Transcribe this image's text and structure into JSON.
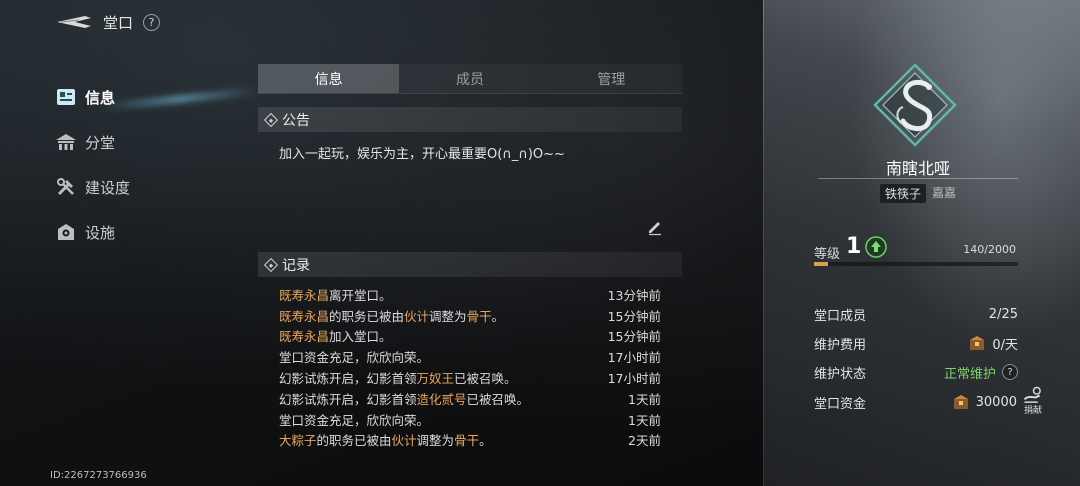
{
  "header": {
    "title": "堂口",
    "help": "?"
  },
  "nav": {
    "items": [
      {
        "label": "信息",
        "icon": "info-icon",
        "active": true
      },
      {
        "label": "分堂",
        "icon": "hall-icon",
        "active": false
      },
      {
        "label": "建设度",
        "icon": "build-tools-icon",
        "active": false
      },
      {
        "label": "设施",
        "icon": "facility-icon",
        "active": false
      }
    ]
  },
  "player_id": "ID:2267273766936",
  "tabs": [
    {
      "label": "信息",
      "active": true
    },
    {
      "label": "成员",
      "active": false
    },
    {
      "label": "管理",
      "active": false
    }
  ],
  "announcement": {
    "heading": "公告",
    "text": "加入一起玩，娱乐为主，开心最重要O(∩_∩)O~~"
  },
  "records": {
    "heading": "记录",
    "rows": [
      {
        "segments": [
          {
            "t": "既寿永昌",
            "hl": true
          },
          {
            "t": "离开堂口。",
            "hl": false
          }
        ],
        "time": "13分钟前"
      },
      {
        "segments": [
          {
            "t": "既寿永昌",
            "hl": true
          },
          {
            "t": "的职务已被由",
            "hl": false
          },
          {
            "t": "伙计",
            "hl": true
          },
          {
            "t": "调整为",
            "hl": false
          },
          {
            "t": "骨干",
            "hl": true
          },
          {
            "t": "。",
            "hl": false
          }
        ],
        "time": "15分钟前"
      },
      {
        "segments": [
          {
            "t": "既寿永昌",
            "hl": true
          },
          {
            "t": "加入堂口。",
            "hl": false
          }
        ],
        "time": "15分钟前"
      },
      {
        "segments": [
          {
            "t": "堂口资金充足，欣欣向荣。",
            "hl": false
          }
        ],
        "time": "17小时前"
      },
      {
        "segments": [
          {
            "t": "幻影试炼开启，幻影首领",
            "hl": false
          },
          {
            "t": "万奴王",
            "hl": true
          },
          {
            "t": "已被召唤。",
            "hl": false
          }
        ],
        "time": "17小时前"
      },
      {
        "segments": [
          {
            "t": "幻影试炼开启，幻影首领",
            "hl": false
          },
          {
            "t": "造化贰号",
            "hl": true
          },
          {
            "t": "已被召唤。",
            "hl": false
          }
        ],
        "time": "1天前"
      },
      {
        "segments": [
          {
            "t": "堂口资金充足，欣欣向荣。",
            "hl": false
          }
        ],
        "time": "1天前"
      },
      {
        "segments": [
          {
            "t": "大粽子",
            "hl": true
          },
          {
            "t": "的职务已被由",
            "hl": false
          },
          {
            "t": "伙计",
            "hl": true
          },
          {
            "t": "调整为",
            "hl": false
          },
          {
            "t": "骨干",
            "hl": true
          },
          {
            "t": "。",
            "hl": false
          }
        ],
        "time": "2天前"
      }
    ]
  },
  "guild": {
    "name": "南瞎北哑",
    "leader_role": "铁筷子",
    "leader_name": "嘉嘉",
    "level_label": "等级",
    "level": "1",
    "exp": "140/2000",
    "exp_fraction": 0.07,
    "stats": {
      "members_label": "堂口成员",
      "members_value": "2/25",
      "upkeep_label": "维护费用",
      "upkeep_value": "0/天",
      "status_label": "维护状态",
      "status_value": "正常维护",
      "funds_label": "堂口资金",
      "funds_value": "30000",
      "donate_label": "捐献"
    }
  },
  "colors": {
    "highlight": "#e8a55a",
    "status_ok": "#7fd36a",
    "exp_bar": "#d4a24a"
  }
}
